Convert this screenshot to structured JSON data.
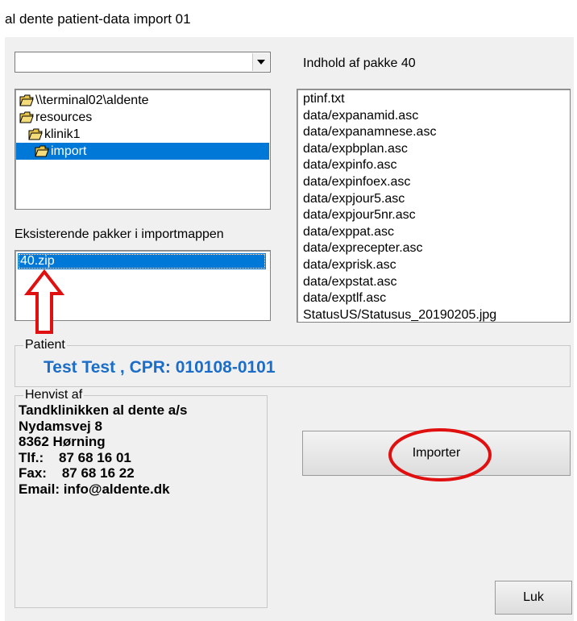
{
  "window": {
    "title": "al dente patient-data import 01"
  },
  "drive_combo": {
    "value": ""
  },
  "folder_tree": {
    "items": [
      {
        "label": "\\\\terminal02\\aldente",
        "selected": false
      },
      {
        "label": "resources",
        "selected": false
      },
      {
        "label": "klinik1",
        "selected": false
      },
      {
        "label": "import",
        "selected": true
      }
    ]
  },
  "package_contents": {
    "label": "Indhold af pakke 40",
    "files": [
      "ptinf.txt",
      "data/expanamid.asc",
      "data/expanamnese.asc",
      "data/expbplan.asc",
      "data/expinfo.asc",
      "data/expinfoex.asc",
      "data/expjour5.asc",
      "data/expjour5nr.asc",
      "data/exppat.asc",
      "data/exprecepter.asc",
      "data/exprisk.asc",
      "data/expstat.asc",
      "data/exptlf.asc",
      "StatusUS/Statusus_20190205.jpg"
    ]
  },
  "packages": {
    "label": "Eksisterende pakker i importmappen",
    "items": [
      {
        "label": "40.zip",
        "selected": true
      }
    ]
  },
  "patient": {
    "legend": "Patient",
    "text": "Test Test , CPR: 010108-0101"
  },
  "referrer": {
    "legend": "Henvist af",
    "lines": [
      "Tandklinikken al dente a/s",
      "Nydamsvej 8",
      "8362 Hørning",
      "Tlf.:    87 68 16 01",
      "Fax:    87 68 16 22",
      "Email: info@aldente.dk"
    ]
  },
  "buttons": {
    "import_label": "Importer",
    "close_label": "Luk"
  },
  "colors": {
    "selection": "#0078d7",
    "patient_text": "#1c6dc8",
    "annotation_red": "#e01010",
    "folder": "#e8c44a"
  }
}
